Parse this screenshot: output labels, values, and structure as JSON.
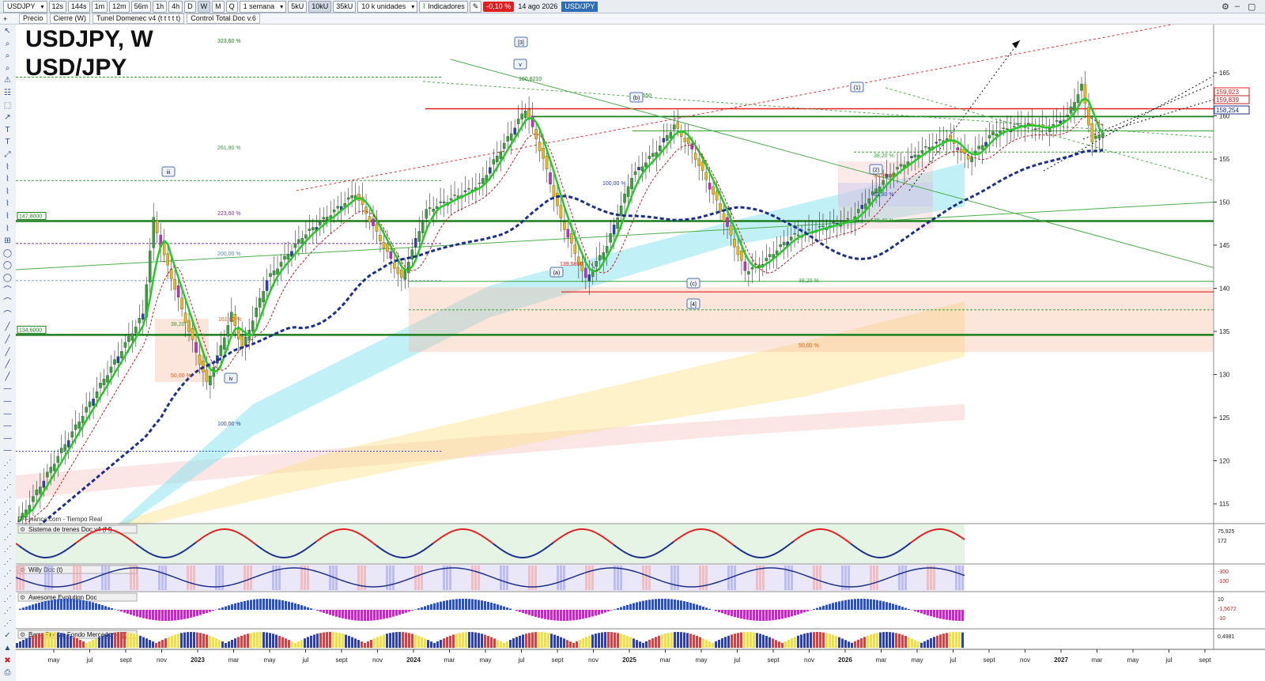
{
  "toolbar": {
    "symbol": "USDJPY",
    "intervals": [
      "12s",
      "144s",
      "1m",
      "12m",
      "56m",
      "1h",
      "4h",
      "D",
      "W",
      "M",
      "Q"
    ],
    "active_interval": "W",
    "period": "1 semana",
    "units": [
      "5kU",
      "10kU",
      "35kU"
    ],
    "active_unit": "10kU",
    "units_select": "10 k unidades",
    "indicators_label": "Indicadores",
    "change": "-0,10 %",
    "date": "14 ago 2026",
    "instrument": "USD/JPY"
  },
  "tabs": [
    "Precio",
    "Cierre (W)",
    "Tunel Domenec v4 (t t t t t)",
    "Control Total Doc v.6"
  ],
  "chart": {
    "title_line1": "USDJPY, W",
    "title_line2": "USD/JPY",
    "source": "IT-Finance.com - Tiempo Real",
    "price_ticks": [
      "165",
      "160",
      "155",
      "150",
      "145",
      "140",
      "135",
      "130",
      "125",
      "120",
      "115"
    ],
    "price_labels": {
      "current1": "159,923",
      "current2": "159,839",
      "current3": "158,254"
    },
    "left_levels": [
      "147,8000",
      "134,6000"
    ],
    "level_labels": {
      "p323": "323,60 %",
      "p261": "261,80 %",
      "p223": "223,60 %",
      "p200": "200,00 %",
      "p100a": "100,00 %",
      "p100b": "100,00 %",
      "p161": "161,80 %",
      "p382a": "38,20",
      "p50a": "50,00 %",
      "p382b": "38,20 %",
      "p50b": "50,00 %",
      "p618": "61,80 %",
      "p764": "76,40 %",
      "p382c": "38,20 %",
      "p50c": "50,00 %",
      "low": "139,5810",
      "high": "160,8210",
      "mid": "158,8650"
    },
    "wave_labels": [
      "[3]",
      "v",
      "iii",
      "iv",
      "(a)",
      "(b)",
      "(c)",
      "[4]",
      "(1)",
      "(2)"
    ],
    "x_ticks": [
      "may",
      "jul",
      "sept",
      "nov",
      "2023",
      "mar",
      "may",
      "jul",
      "sept",
      "nov",
      "2024",
      "mar",
      "may",
      "jul",
      "sept",
      "nov",
      "2025",
      "mar",
      "may",
      "jul",
      "sept",
      "nov",
      "2026",
      "mar",
      "may",
      "jul",
      "sept",
      "nov",
      "2027",
      "mar",
      "may",
      "jul",
      "sept"
    ]
  },
  "indicators": [
    {
      "name": "Sistema de trenes Doc v4 (f f)",
      "values": [
        "75,925",
        "172"
      ]
    },
    {
      "name": "Willy Doc (t)",
      "values": [
        "-300",
        "-100"
      ]
    },
    {
      "name": "Awesome Evolution Doc",
      "values": [
        "10",
        "-1,5672",
        "-10"
      ]
    },
    {
      "name": "Barra Fuerza Fondo Mercado v4 (f)",
      "values": [
        "0,4981"
      ]
    }
  ],
  "colors": {
    "up": "#2aa52a",
    "down": "#e03030",
    "trend_blue": "#1c2f8a",
    "accent_green": "#1f8f1f"
  }
}
